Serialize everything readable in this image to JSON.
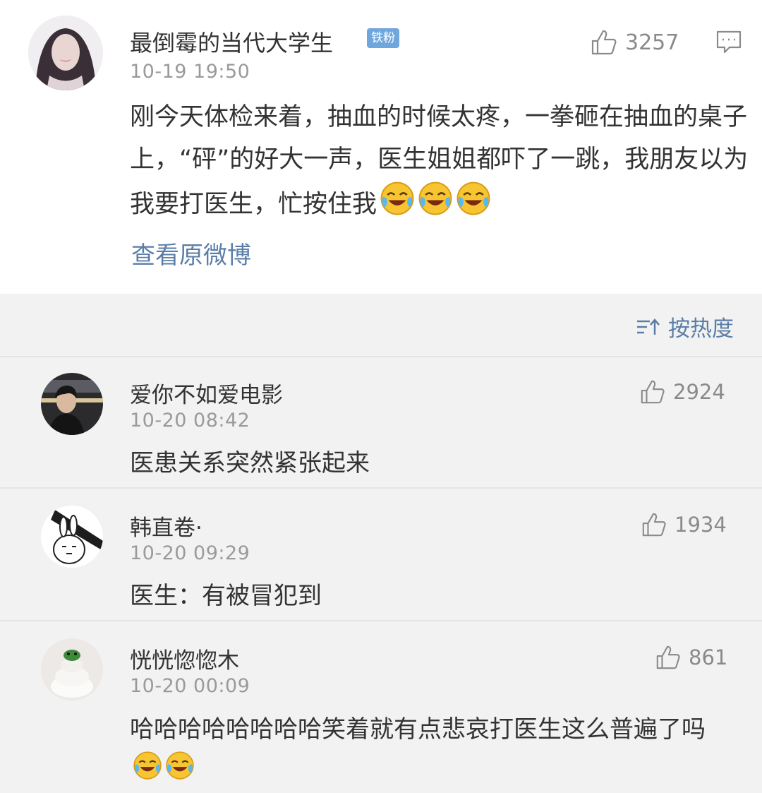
{
  "post": {
    "username": "最倒霉的当代大学生",
    "badge": "铁粉",
    "time": "10-19 19:50",
    "likes": "3257",
    "text": "刚今天体检来着，抽血的时候太疼，一拳砸在抽血的桌子上，“砰”的好大一声，医生姐姐都吓了一跳，我朋友以为我要打医生，忙按住我",
    "emojis": [
      "laugh-cry-emoji",
      "laugh-cry-emoji",
      "laugh-cry-emoji"
    ],
    "view_original": "查看原微博"
  },
  "sort": {
    "label": "按热度",
    "icon": "sort-icon"
  },
  "comments": [
    {
      "username": "爱你不如爱电影",
      "time": "10-20 08:42",
      "likes": "2924",
      "text": "医患关系突然紧张起来"
    },
    {
      "username": "韩直卷·",
      "time": "10-20 09:29",
      "likes": "1934",
      "text": "医生：有被冒犯到"
    },
    {
      "username": "恍恍惚惚木",
      "time": "10-20 00:09",
      "likes": "861",
      "text": "哈哈哈哈哈哈哈哈笑着就有点悲哀打医生这么普遍了吗",
      "emojis": [
        "laugh-cry-emoji",
        "laugh-cry-emoji"
      ]
    }
  ],
  "colors": {
    "link": "#5b7ea8",
    "badge": "#6fa6dd",
    "background": "#f2f2f2"
  }
}
